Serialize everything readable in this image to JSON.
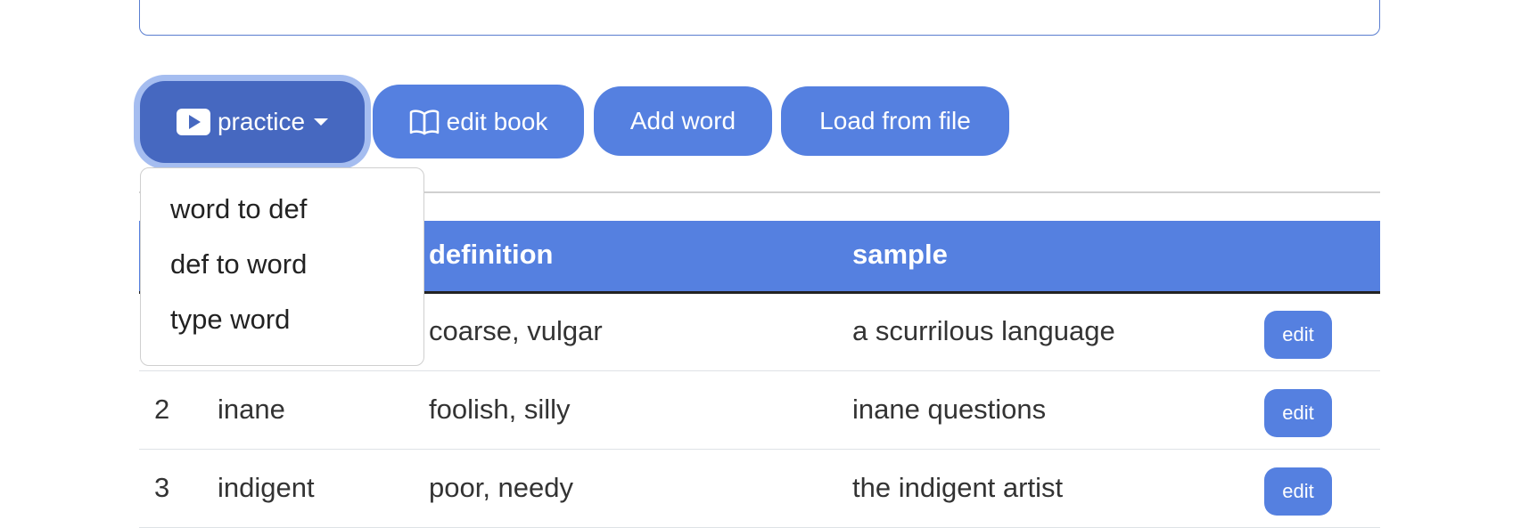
{
  "toolbar": {
    "practice_label": "practice",
    "edit_book_label": "edit book",
    "add_word_label": "Add word",
    "load_file_label": "Load from file"
  },
  "dropdown": {
    "items": [
      "word to def",
      "def to word",
      "type word"
    ]
  },
  "table": {
    "headers": [
      "definition",
      "sample"
    ],
    "rows": [
      {
        "num": "",
        "word": "",
        "definition": "coarse, vulgar",
        "sample": "a scurrilous language",
        "action": "edit"
      },
      {
        "num": "2",
        "word": "inane",
        "definition": "foolish, silly",
        "sample": "inane questions",
        "action": "edit"
      },
      {
        "num": "3",
        "word": "indigent",
        "definition": "poor, needy",
        "sample": "the indigent artist",
        "action": "edit"
      }
    ]
  },
  "colors": {
    "accent": "#5580e0",
    "accent_active": "#4668c0",
    "focus_ring": "#a5bdf0"
  },
  "icons": [
    "play-icon",
    "caret-down-icon",
    "book-icon"
  ]
}
